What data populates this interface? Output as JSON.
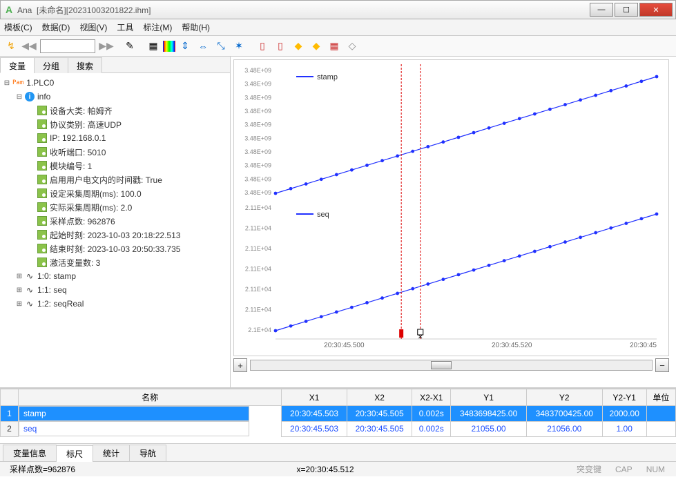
{
  "window": {
    "app": "Ana",
    "title_unnamed": "[未命名]",
    "title_file": "[20231003201822.ihm]"
  },
  "menu": {
    "template": "模板(C)",
    "data": "数据(D)",
    "view": "视图(V)",
    "tool": "工具",
    "annotate": "标注(M)",
    "help": "帮助(H)"
  },
  "side_tabs": {
    "var": "变量",
    "group": "分组",
    "search": "搜索"
  },
  "tree": {
    "root": "1.PLC0",
    "info": "info",
    "items": [
      "设备大类: 帕姆齐",
      "协议类别: 高速UDP",
      "IP: 192.168.0.1",
      "收听端口: 5010",
      "模块编号: 1",
      "启用用户电文内的时间戳: True",
      "设定采集周期(ms): 100.0",
      "实际采集周期(ms): 2.0",
      "采样点数: 962876",
      "起始时刻: 2023-10-03 20:18:22.513",
      "结束时刻: 2023-10-03 20:50:33.735",
      "激活变量数: 3"
    ],
    "vars": [
      "1:0: stamp",
      "1:1: seq",
      "1:2: seqReal"
    ]
  },
  "chart_data": {
    "type": "line",
    "panels": [
      {
        "label": "stamp",
        "yticks": [
          "3.48E+09",
          "3.48E+09",
          "3.48E+09",
          "3.48E+09",
          "3.48E+09",
          "3.48E+09",
          "3.48E+09",
          "3.48E+09",
          "3.48E+09",
          "3.48E+09"
        ],
        "series_color": "#2030ff",
        "x": [
          "20:30:45.490",
          "20:30:45.495",
          "20:30:45.500",
          "20:30:45.505",
          "20:30:45.510",
          "20:30:45.515",
          "20:30:45.520",
          "20:30:45.525",
          "20:30:45.530",
          "20:30:45.535",
          "20:30:45.540",
          "20:30:45.545"
        ],
        "y_estimate": [
          3483696000,
          3483696500,
          3483697000,
          3483697500,
          3483698000,
          3483698500,
          3483699000,
          3483699500,
          3483700000,
          3483700500,
          3483701000,
          3483701500
        ]
      },
      {
        "label": "seq",
        "yticks": [
          "2.11E+04",
          "2.11E+04",
          "2.11E+04",
          "2.11E+04",
          "2.11E+04",
          "2.11E+04",
          "2.1E+04"
        ],
        "series_color": "#2030ff",
        "x": [
          "20:30:45.490",
          "20:30:45.495",
          "20:30:45.500",
          "20:30:45.505",
          "20:30:45.510",
          "20:30:45.515",
          "20:30:45.520",
          "20:30:45.525",
          "20:30:45.530",
          "20:30:45.535",
          "20:30:45.540",
          "20:30:45.545"
        ],
        "y_estimate": [
          21048,
          21049,
          21050,
          21051,
          21052,
          21053,
          21054,
          21055,
          21056,
          21057,
          21058,
          21059
        ]
      }
    ],
    "xticks": [
      "20:30:45.500",
      "20:30:45.520",
      "20:30:45"
    ],
    "cursors": {
      "x1": "20:30:45.503",
      "x2": "20:30:45.505"
    }
  },
  "grid": {
    "headers": {
      "name": "名称",
      "x1": "X1",
      "x2": "X2",
      "dx": "X2-X1",
      "y1": "Y1",
      "y2": "Y2",
      "dy": "Y2-Y1",
      "unit": "单位"
    },
    "rows": [
      {
        "idx": "1",
        "name": "stamp",
        "x1": "20:30:45.503",
        "x2": "20:30:45.505",
        "dx": "0.002s",
        "y1": "3483698425.00",
        "y2": "3483700425.00",
        "dy": "2000.00",
        "unit": ""
      },
      {
        "idx": "2",
        "name": "seq",
        "x1": "20:30:45.503",
        "x2": "20:30:45.505",
        "dx": "0.002s",
        "y1": "21055.00",
        "y2": "21056.00",
        "dy": "1.00",
        "unit": ""
      }
    ]
  },
  "bottom_tabs": {
    "varinfo": "变量信息",
    "ruler": "标尺",
    "stats": "统计",
    "nav": "导航"
  },
  "status": {
    "left": "采样点数=962876",
    "mid": "x=20:30:45.512",
    "r1": "突变键",
    "cap": "CAP",
    "num": "NUM"
  },
  "scroll": {
    "plus": "+",
    "minus": "−"
  }
}
